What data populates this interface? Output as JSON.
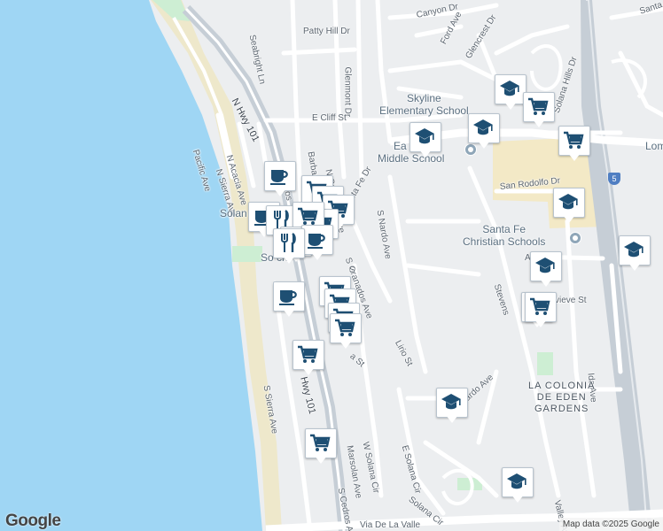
{
  "map": {
    "colors": {
      "water": "#9fd6f4",
      "land": "#eceef0",
      "road": "#ffffff",
      "highway": "#c6ced6",
      "park": "#cdeed3",
      "sand": "#eee8cb",
      "marker_icon": "#1e4f73"
    },
    "streets": [
      {
        "id": "hwy-101-north",
        "text": "N Hwy 101"
      },
      {
        "id": "seabright-ln",
        "text": "Seabright Ln"
      },
      {
        "id": "patty-hill-dr",
        "text": "Patty Hill Dr"
      },
      {
        "id": "canyon-dr",
        "text": "Canyon Dr"
      },
      {
        "id": "ford-ave",
        "text": "Ford Ave"
      },
      {
        "id": "glencrest-dr",
        "text": "Glencrest Dr"
      },
      {
        "id": "glenmont-dr",
        "text": "Glenmont Dr"
      },
      {
        "id": "e-cliff-st",
        "text": "E Cliff St"
      },
      {
        "id": "pacific-ave",
        "text": "Pacific Ave"
      },
      {
        "id": "n-acacia-ave",
        "text": "N Acacia Ave"
      },
      {
        "id": "n-sierra-ave",
        "text": "N Sierra Ave"
      },
      {
        "id": "n-cedros",
        "text": "N Cedros"
      },
      {
        "id": "barbara-ave",
        "text": "Barbara Ave"
      },
      {
        "id": "n-granados-ave",
        "text": "N Granados Ave"
      },
      {
        "id": "santa-fe-dr",
        "text": "nta Fe Dr"
      },
      {
        "id": "s-nardo-ave",
        "text": "S Nardo Ave"
      },
      {
        "id": "s-granados-ave",
        "text": "S Granados Ave"
      },
      {
        "id": "san-rodolfo-dr",
        "text": "San Rodolfo Dr"
      },
      {
        "id": "lirio-st",
        "text": "Lirio St"
      },
      {
        "id": "stevens",
        "text": "Stevens"
      },
      {
        "id": "s-sierra-ave",
        "text": "S Sierra Ave"
      },
      {
        "id": "hwy-101-south",
        "text": "Hwy 101"
      },
      {
        "id": "w-solana-cir",
        "text": "W Solana Cir"
      },
      {
        "id": "e-solana-cir",
        "text": "E Solana Cir"
      },
      {
        "id": "marsolan-ave",
        "text": "Marsolan Ave"
      },
      {
        "id": "s-cedros-ave",
        "text": "S Cedros Ave"
      },
      {
        "id": "solana-cir",
        "text": "Solana Cir"
      },
      {
        "id": "via-de-la-valle",
        "text": "Via De La Valle"
      },
      {
        "id": "ida-ave",
        "text": "Ida Ave"
      },
      {
        "id": "valley-ave",
        "text": "Valley Av"
      },
      {
        "id": "nardo-ave",
        "text": "ardo Ave"
      },
      {
        "id": "santa-top",
        "text": "Santa"
      },
      {
        "id": "lom",
        "text": "Lom"
      },
      {
        "id": "solana-hills-dr",
        "text": "Solana Hills Dr"
      },
      {
        "id": "ac-dr",
        "text": "Ac   Dr"
      },
      {
        "id": "vieve-st",
        "text": "vieve St"
      },
      {
        "id": "solana-beach-1",
        "text": "Solan"
      },
      {
        "id": "solana-beach-2",
        "text": "So      ch"
      },
      {
        "id": "s-fragment",
        "text": "S"
      },
      {
        "id": "a-st",
        "text": "a St"
      }
    ],
    "places": [
      {
        "id": "skyline-school",
        "lines": [
          "Skyline",
          "Elementary School"
        ]
      },
      {
        "id": "earl-warren",
        "lines": [
          "Ea      rren",
          "Middle School"
        ]
      },
      {
        "id": "santa-fe-christian",
        "lines": [
          "Santa Fe",
          "Christian Schools"
        ]
      },
      {
        "id": "la-colonia",
        "lines": [
          "LA COLONIA",
          "DE EDEN",
          "GARDENS"
        ]
      }
    ],
    "route_shields": [
      {
        "id": "i5-shield",
        "text": "5"
      }
    ],
    "markers": [
      {
        "type": "school"
      },
      {
        "type": "shopping"
      },
      {
        "type": "school"
      },
      {
        "type": "shopping"
      },
      {
        "type": "school"
      },
      {
        "type": "school"
      },
      {
        "type": "shopping"
      },
      {
        "type": "school"
      },
      {
        "type": "school"
      },
      {
        "type": "shopping"
      },
      {
        "type": "school"
      },
      {
        "type": "school"
      },
      {
        "type": "coffee"
      },
      {
        "type": "shopping"
      },
      {
        "type": "shopping"
      },
      {
        "type": "shopping"
      },
      {
        "type": "shopping"
      },
      {
        "type": "coffee"
      },
      {
        "type": "restaurant"
      },
      {
        "type": "shopping"
      },
      {
        "type": "restaurant"
      },
      {
        "type": "coffee"
      },
      {
        "type": "restaurant"
      },
      {
        "type": "shopping"
      },
      {
        "type": "shopping"
      },
      {
        "type": "shopping"
      },
      {
        "type": "shopping"
      },
      {
        "type": "coffee"
      },
      {
        "type": "shopping"
      },
      {
        "type": "shopping"
      }
    ],
    "logo": "Google",
    "attribution": "Map data ©2025 Google"
  }
}
